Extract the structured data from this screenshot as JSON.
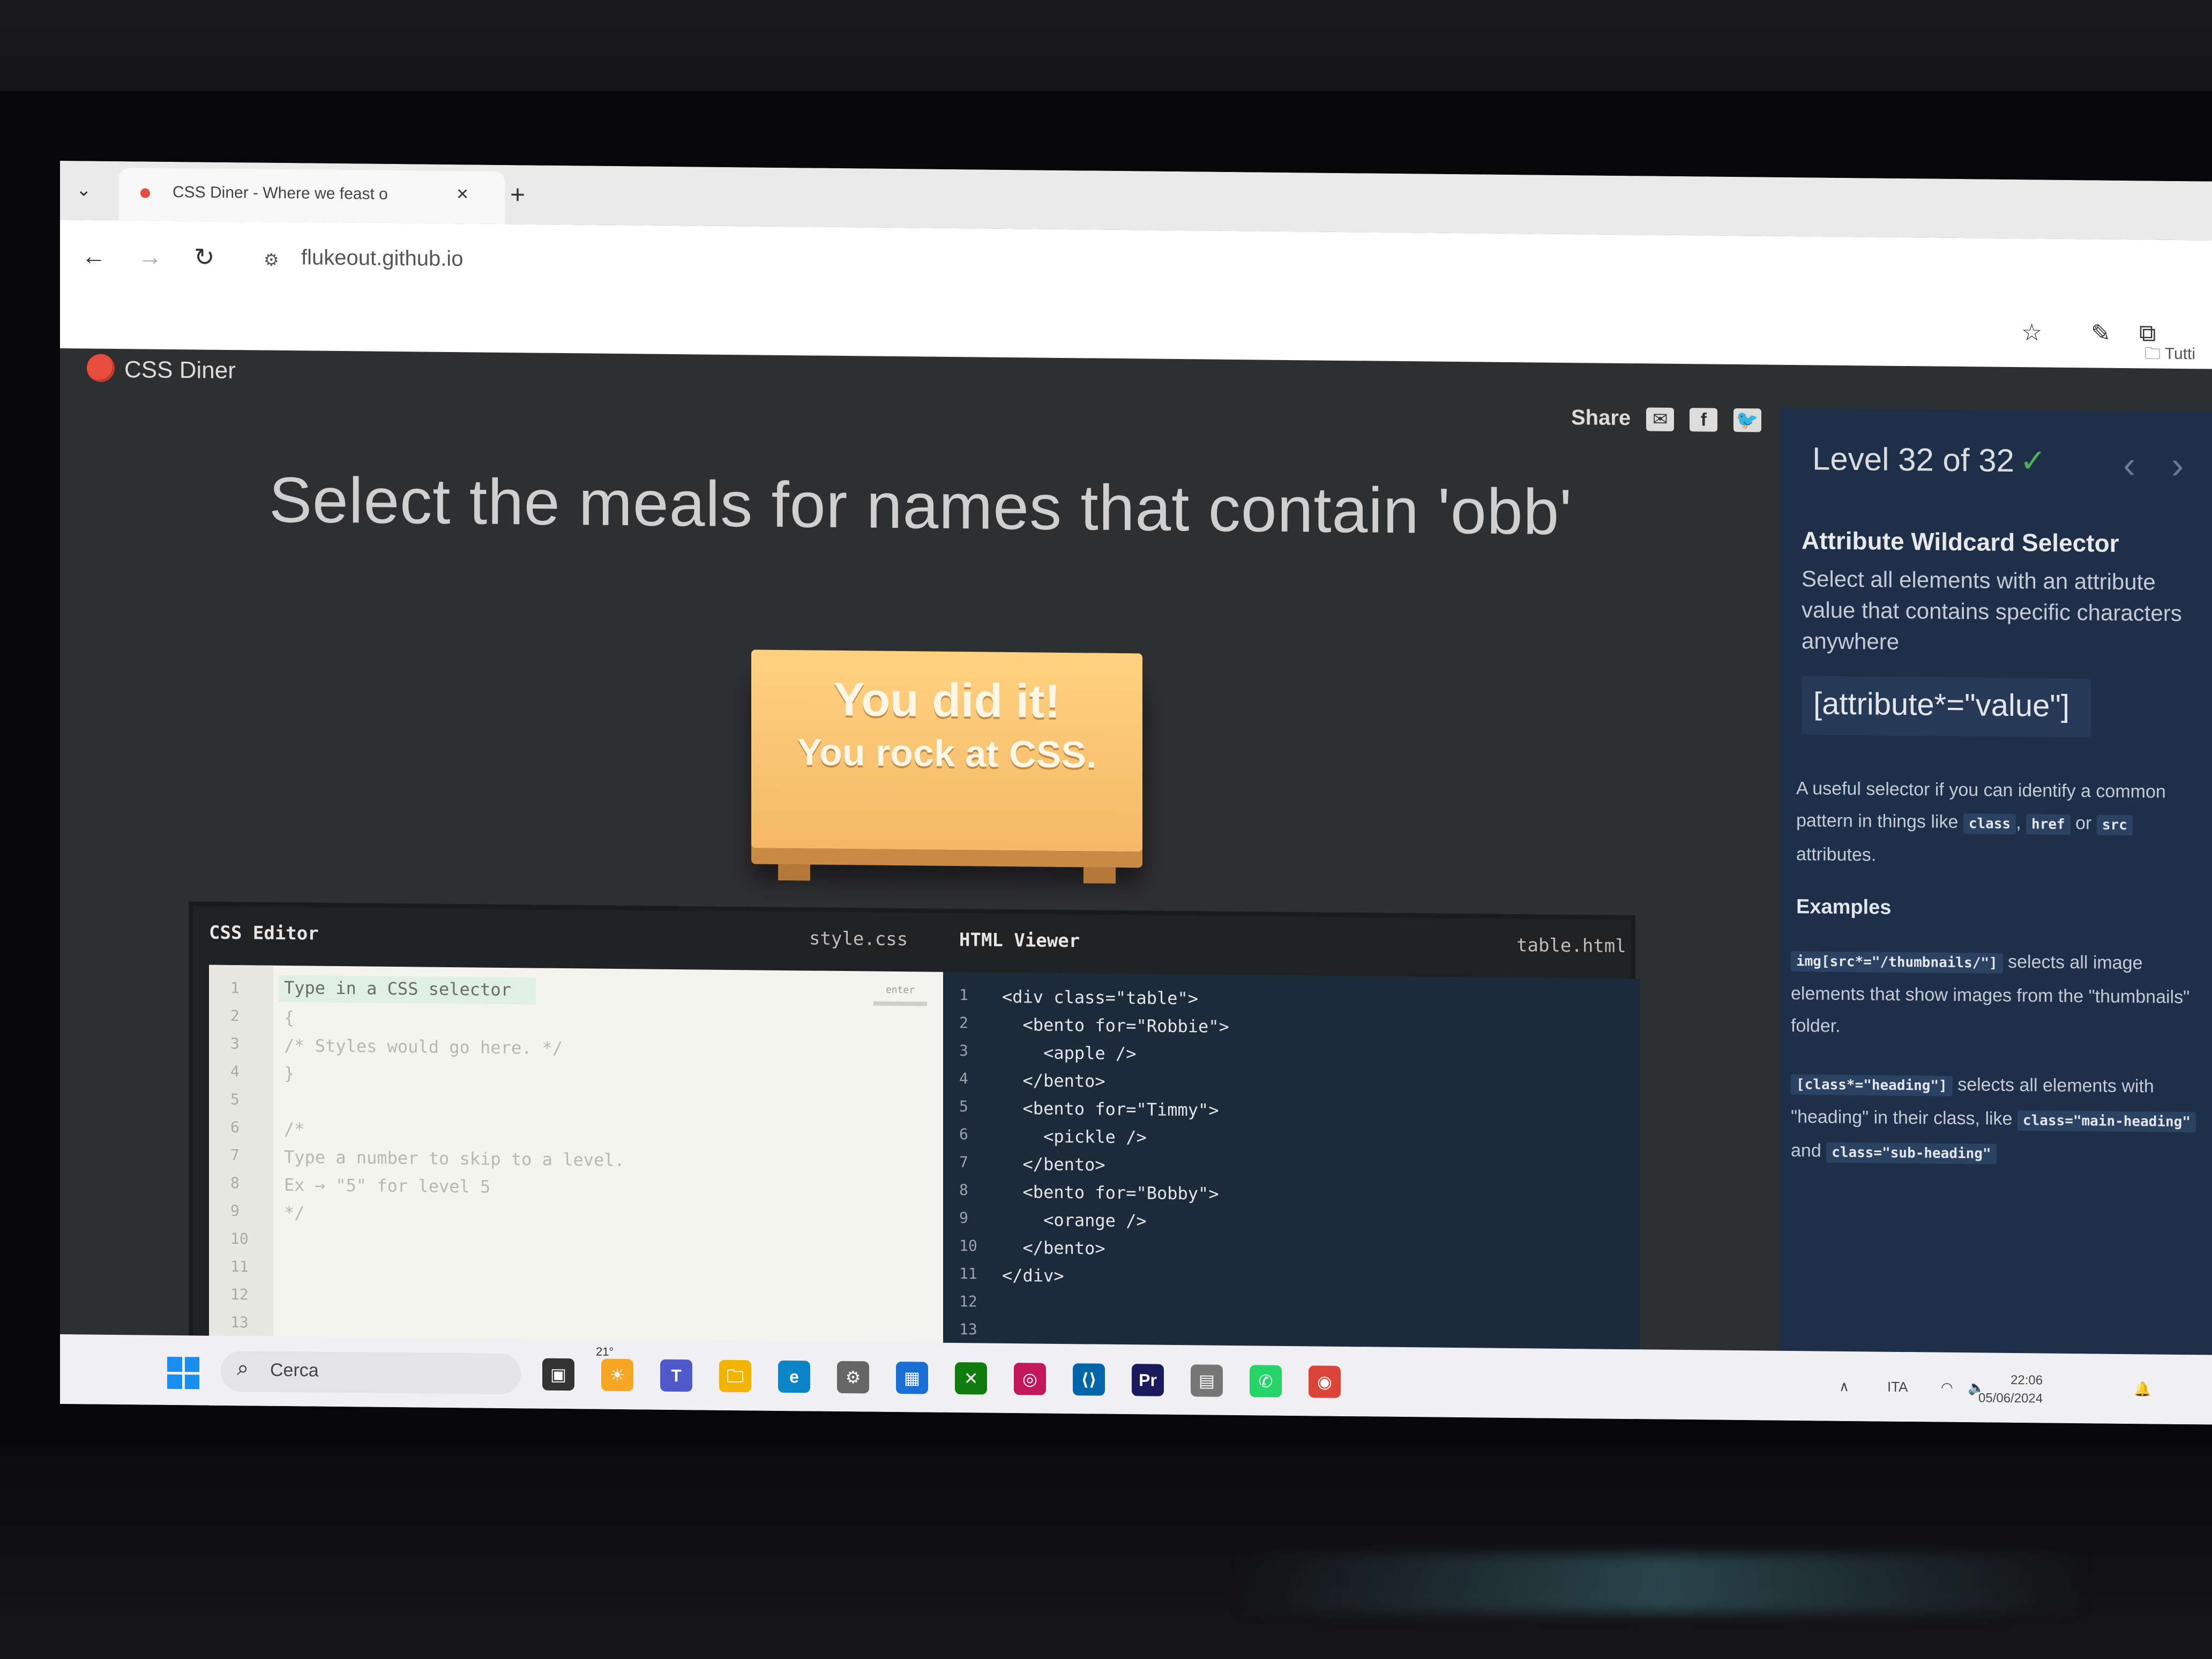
{
  "browser": {
    "tab_title": "CSS Diner - Where we feast o",
    "url": "flukeout.github.io",
    "bookmarks_folder": "Tutti"
  },
  "site": {
    "name": "CSS Diner",
    "share_label": "Share"
  },
  "main": {
    "order": "Select the meals for names that contain 'obb'",
    "win_line1": "You did it!",
    "win_line2": "You rock at CSS."
  },
  "css_editor": {
    "title": "CSS Editor",
    "file": "style.css",
    "placeholder": "Type in a CSS selector",
    "enter_label": "enter",
    "lines": [
      "{",
      "/* Styles would go here. */",
      "}",
      "",
      "/*",
      "Type a number to skip to a level.",
      "Ex → \"5\" for level 5",
      "*/",
      "",
      "",
      ""
    ],
    "line_numbers": [
      "1",
      "2",
      "3",
      "4",
      "5",
      "6",
      "7",
      "8",
      "9",
      "10",
      "11",
      "12",
      "13"
    ]
  },
  "html_viewer": {
    "title": "HTML Viewer",
    "file": "table.html",
    "lines": [
      "<div class=\"table\">",
      "  <bento for=\"Robbie\">",
      "    <apple />",
      "  </bento>",
      "  <bento for=\"Timmy\">",
      "    <pickle />",
      "  </bento>",
      "  <bento for=\"Bobby\">",
      "    <orange />",
      "  </bento>",
      "</div>",
      ""
    ],
    "line_numbers": [
      "1",
      "2",
      "3",
      "4",
      "5",
      "6",
      "7",
      "8",
      "9",
      "10",
      "11",
      "12",
      "13"
    ]
  },
  "sidebar": {
    "level": "Level 32 of 32",
    "level_check": "✓",
    "selector_name": "Attribute Wildcard Selector",
    "selector_title": "Select all elements with an attribute value that contains specific characters anywhere",
    "syntax": "[attribute*=\"value\"]",
    "hint_before": "A useful selector if you can identify a common pattern in things like",
    "hint_chip1": "class",
    "hint_sep": ",",
    "hint_chip2": "href",
    "hint_or": "or",
    "hint_chip3": "src",
    "hint_after": "attributes.",
    "examples_title": "Examples",
    "ex1_code": "img[src*=\"/thumbnails/\"]",
    "ex1_text": "selects all image elements that show images from the \"thumbnails\" folder.",
    "ex2_code": "[class*=\"heading\"]",
    "ex2_text1": "selects all elements with \"heading\" in their class, like",
    "ex2_chip1": "class=\"main-heading\"",
    "ex2_and": "and",
    "ex2_chip2": "class=\"sub-heading\""
  },
  "taskbar": {
    "search_placeholder": "Cerca",
    "weather": "21°",
    "lang": "ITA",
    "time": "22:06",
    "date": "05/06/2024"
  },
  "colors": {
    "page_bg": "#2e2f31",
    "sidebar_bg": "#1e2f4a",
    "table_top": "#ffd27f",
    "check_green": "#4caf50",
    "logo_red": "#e74c3c"
  }
}
